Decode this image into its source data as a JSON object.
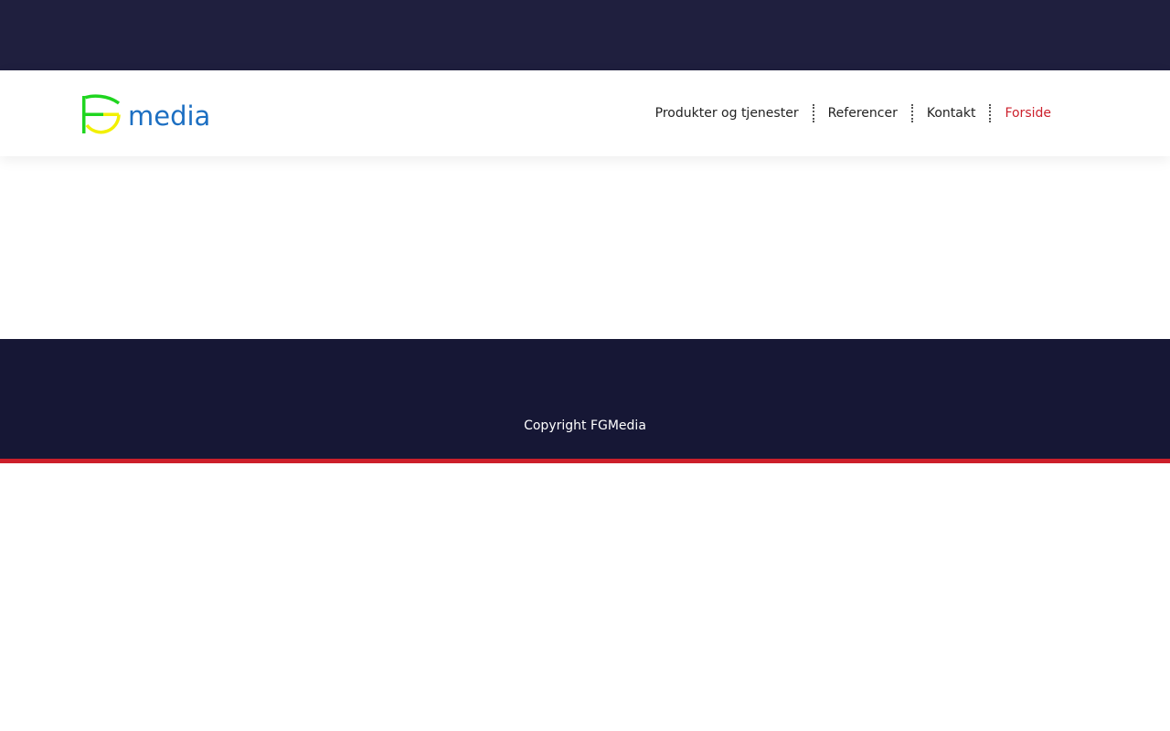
{
  "logo": {
    "mark_text": "FG",
    "word_text": "media",
    "colors": {
      "green": "#1fd51f",
      "yellow": "#f2f000",
      "blue": "#1c6fc2"
    }
  },
  "nav": {
    "items": [
      {
        "label": "Produkter og tjenester",
        "active": false
      },
      {
        "label": "Referencer",
        "active": false
      },
      {
        "label": "Kontakt",
        "active": false
      },
      {
        "label": "Forside",
        "active": true
      }
    ]
  },
  "footer": {
    "copyright": "Copyright FGMedia"
  },
  "colors": {
    "top_band": "#1f1f3e",
    "footer_bg": "#161735",
    "accent_red": "#cc1f2b"
  }
}
